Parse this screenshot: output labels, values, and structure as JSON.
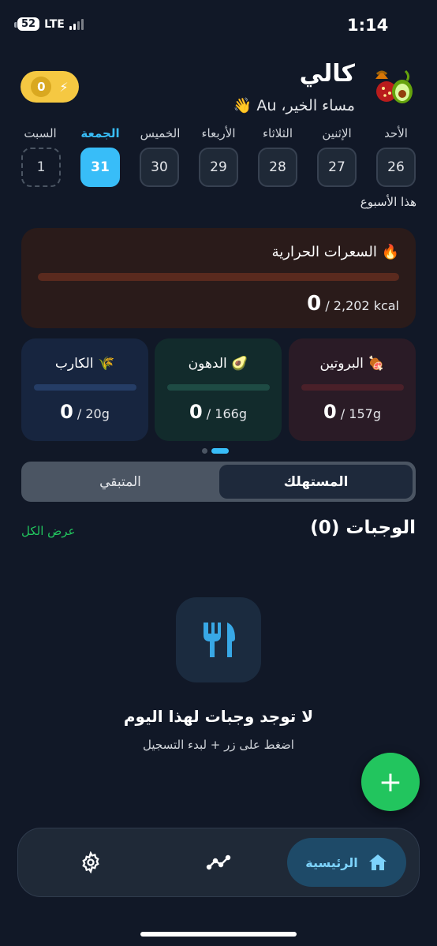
{
  "status_bar": {
    "time": "1:14",
    "battery": "52",
    "network": "LTE"
  },
  "header": {
    "streak_count": "0",
    "app_name": "كالي",
    "greeting": "مساء الخير، Au 👋"
  },
  "week": {
    "label": "هذا الأسبوع",
    "days": [
      {
        "name": "الأحد",
        "date": "26"
      },
      {
        "name": "الإثنين",
        "date": "27"
      },
      {
        "name": "الثلاثاء",
        "date": "28"
      },
      {
        "name": "الأربعاء",
        "date": "29"
      },
      {
        "name": "الخميس",
        "date": "30"
      },
      {
        "name": "الجمعة",
        "date": "31",
        "selected": true
      },
      {
        "name": "السبت",
        "date": "1",
        "future": true
      }
    ]
  },
  "calories": {
    "title": "السعرات الحرارية",
    "icon": "fire-icon",
    "consumed": "0",
    "goal": " / 2,202 kcal"
  },
  "macros": [
    {
      "name": "البروتين",
      "icon": "meat-icon",
      "consumed": "0",
      "goal": " / 157g"
    },
    {
      "name": "الدهون",
      "icon": "avocado-icon",
      "consumed": "0",
      "goal": " / 166g"
    },
    {
      "name": "الكارب",
      "icon": "wheat-icon",
      "consumed": "0",
      "goal": " / 20g"
    }
  ],
  "toggle": {
    "consumed": "المستهلك",
    "remaining": "المتبقي",
    "selected": "consumed"
  },
  "meals": {
    "title": "الوجبات (0)",
    "view_all": "عرض الكل",
    "empty_title": "لا توجد وجبات لهذا اليوم",
    "empty_subtitle": "اضغط على زر + لبدء التسجيل"
  },
  "fab": {
    "label": "+"
  },
  "nav": {
    "home_label": "الرئيسية"
  },
  "colors": {
    "background": "#111827",
    "accent": "#38bdf8",
    "success": "#22c55e",
    "streak": "#f5c842"
  }
}
